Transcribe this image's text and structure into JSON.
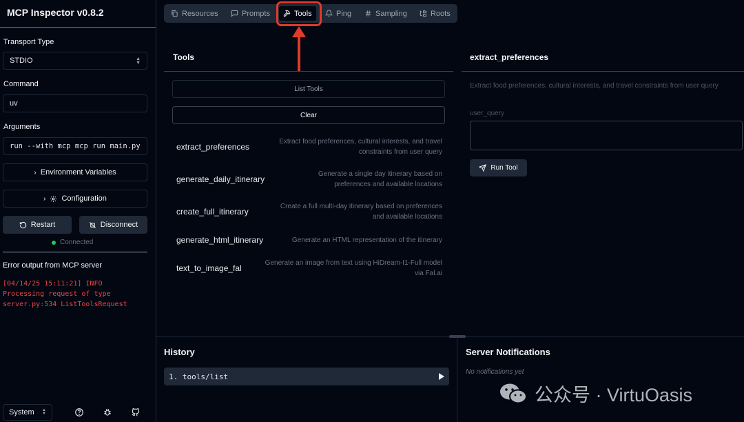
{
  "sidebar": {
    "app_title": "MCP Inspector v0.8.2",
    "transport_label": "Transport Type",
    "transport_value": "STDIO",
    "command_label": "Command",
    "command_value": "uv",
    "arguments_label": "Arguments",
    "arguments_value": "run --with mcp mcp run main.py",
    "env_vars_label": "Environment Variables",
    "configuration_label": "Configuration",
    "restart_label": "Restart",
    "disconnect_label": "Disconnect",
    "status_text": "Connected",
    "status_color": "#22c55e",
    "error_heading": "Error output from MCP server",
    "error_lines": [
      "[04/14/25 15:11:21] INFO",
      "Processing request of type",
      "server.py:534 ListToolsRequest"
    ],
    "theme_value": "System"
  },
  "tabs": [
    "Resources",
    "Prompts",
    "Tools",
    "Ping",
    "Sampling",
    "Roots"
  ],
  "active_tab": "Tools",
  "tools_panel": {
    "title": "Tools",
    "list_button": "List Tools",
    "clear_button": "Clear",
    "tools": [
      {
        "name": "extract_preferences",
        "desc": [
          "Extract food preferences, cultural interests, and travel",
          "constraints from user query"
        ]
      },
      {
        "name": "generate_daily_itinerary",
        "desc": [
          "Generate a single day itinerary based on",
          "preferences and available locations"
        ]
      },
      {
        "name": "create_full_itinerary",
        "desc": [
          "Create a full multi-day itinerary based on preferences",
          "and available locations"
        ]
      },
      {
        "name": "generate_html_itinerary",
        "desc": [
          "Generate an HTML representation of the itinerary"
        ]
      },
      {
        "name": "text_to_image_fal",
        "desc": [
          "Generate an image from text using HiDream-I1-Full model",
          "via Fal.ai"
        ]
      }
    ]
  },
  "detail_panel": {
    "title": "extract_preferences",
    "description": "Extract food preferences, cultural interests, and travel constraints from user query",
    "param_label": "user_query",
    "param_value": "",
    "run_button": "Run Tool"
  },
  "history": {
    "title": "History",
    "items": [
      "1. tools/list"
    ]
  },
  "notifications": {
    "title": "Server Notifications",
    "empty_text": "No notifications yet"
  },
  "watermark": {
    "text": "公众号 · VirtuOasis"
  },
  "highlight_color": "#e03a2a"
}
